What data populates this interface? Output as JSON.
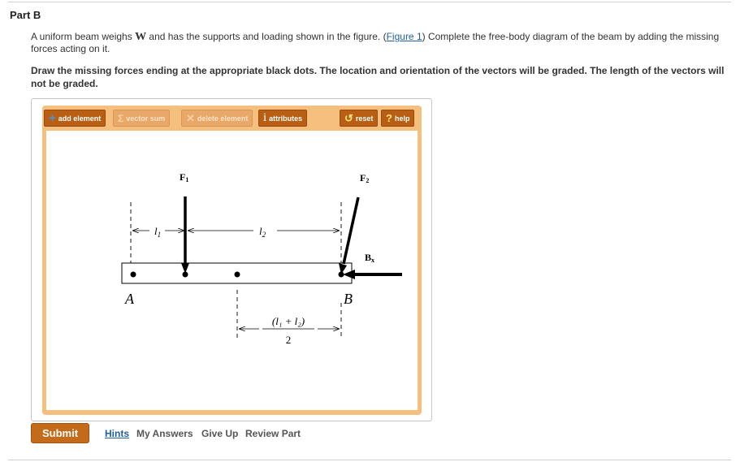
{
  "part": {
    "title": "Part B"
  },
  "problem": {
    "text_before_w": "A uniform beam weighs ",
    "weight_symbol": "W",
    "text_after_w": " and has the supports and loading shown in the figure. (",
    "figure_link": "Figure 1",
    "text_after_link": ") Complete the free-body diagram of the beam by adding the missing forces acting on it.",
    "instructions": "Draw the missing forces ending at the appropriate black dots. The location and orientation of the vectors will be graded. The length of the vectors will not be graded."
  },
  "toolbar": {
    "add_element": "add element",
    "vector_sum": "vector sum",
    "delete_element": "delete element",
    "attributes": "attributes",
    "reset": "reset",
    "help": "help",
    "icons": {
      "add": "plus-icon",
      "vector_sum": "sigma-icon",
      "delete": "x-icon",
      "attributes": "info-icon",
      "reset": "reset-icon",
      "help": "question-icon"
    }
  },
  "diagram": {
    "f1_main": "F",
    "f1_sub": "1",
    "f2_main": "F",
    "f2_sub": "2",
    "bx_main": "B",
    "bx_sub": "x",
    "l1_main": "l",
    "l1_sub": "1",
    "l2_main": "l",
    "l2_sub": "2",
    "point_a": "A",
    "point_b": "B",
    "frac_numerator": "(l₁ + l₂)",
    "frac_denominator": "2"
  },
  "footer": {
    "submit": "Submit",
    "hints": "Hints",
    "my_answers": "My Answers",
    "give_up": "Give Up",
    "review_part": "Review Part"
  },
  "colors": {
    "toolbar_frame": "#f5c07e",
    "button": "#b85f14",
    "button_disabled": "#e8a867",
    "submit": "#c46a1b",
    "link": "#1e5f9e"
  }
}
